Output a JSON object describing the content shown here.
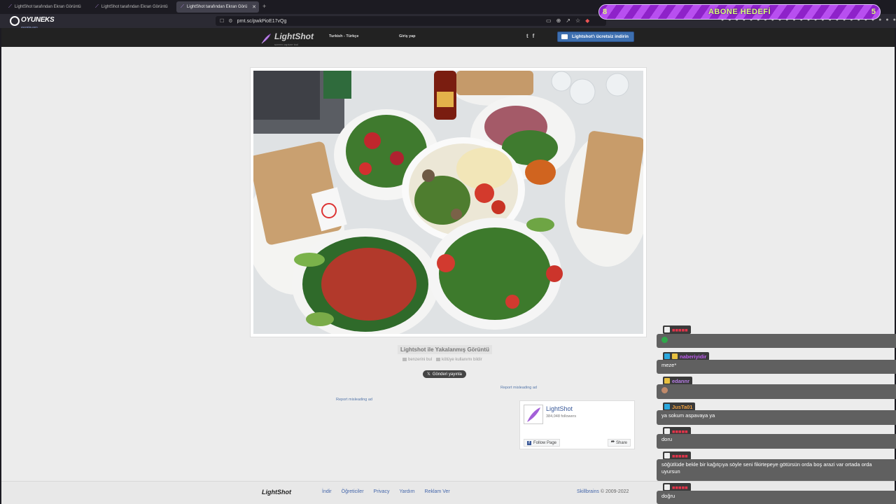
{
  "browser": {
    "tabs": [
      {
        "title": "LightShot tarafından Ekran Görüntü"
      },
      {
        "title": "LightShot tarafından Ekran Görüntü"
      },
      {
        "title": "LightShot tarafından Ekran Görü"
      }
    ],
    "url": "prnt.sc/pwkPioE17vQg"
  },
  "overlay": {
    "logo": "OYUNEKS",
    "logo_sub": "oyuneks.com",
    "sub_goal": {
      "title": "ABONE HEDEFİ",
      "current": "8",
      "target": "5"
    }
  },
  "lightshot": {
    "logo_name": "LightShot",
    "logo_tagline": "screen capture tool",
    "language": "Turkish - Türkçe",
    "login": "Giriş yap",
    "social": {
      "twitter": "t",
      "facebook": "f"
    },
    "download_button": "Lightshot'ı ücretsiz indirin",
    "caption": "Lightshot ile Yakalanmış Görüntü",
    "similar_link": "benzerini bul",
    "report_abuse_link": "kötüye kullanımı bildir",
    "tweet_button": "Gönderi yayınla",
    "report_ad_left": "Report misleading ad",
    "report_ad_right": "Report misleading ad",
    "facebook": {
      "page_name": "LightShot",
      "followers": "384,048 followers",
      "follow_button": "Follow Page",
      "share_button": "Share"
    },
    "footer": {
      "logo": "LightShot",
      "links": [
        "İndir",
        "Öğreticiler",
        "Privacy",
        "Yardım",
        "Reklam Ver"
      ],
      "company": "Skillbrains",
      "copyright": "© 2009-2022"
    }
  },
  "chat": [
    {
      "user": "■■■■■",
      "color": "#e0344a",
      "text": ""
    },
    {
      "user": "naberiyidir",
      "color": "#c05cf0",
      "text": "meze*"
    },
    {
      "user": "edannr",
      "color": "#b77de8",
      "text": ""
    },
    {
      "user": "JusTa01",
      "color": "#f0a040",
      "text": "ya sokum aspavaya ya"
    },
    {
      "user": "■■■■■",
      "color": "#e0344a",
      "text": "doru"
    },
    {
      "user": "■■■■■",
      "color": "#e0344a",
      "text": "söğütlüde bekle bir kağıtçıya söyle seni fikirtepeye götürsün orda boş arazi var ortada orda uyursun"
    },
    {
      "user": "■■■■■",
      "color": "#e0344a",
      "text": "doğru"
    }
  ],
  "colors": {
    "accent_purple": "#b84ff0",
    "goal_text": "#d8ff7a",
    "download_blue": "#3d6fb0",
    "link_blue": "#4466aa"
  }
}
